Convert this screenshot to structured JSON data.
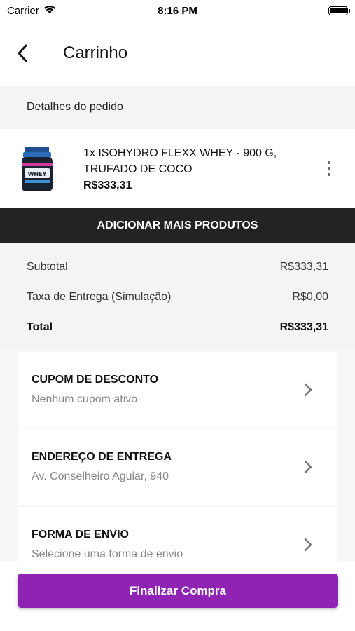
{
  "status_bar": {
    "carrier": "Carrier",
    "time": "8:16 PM"
  },
  "header": {
    "title": "Carrinho"
  },
  "order": {
    "section_title": "Detalhes do pedido",
    "items": [
      {
        "name": "1x ISOHYDRO FLEXX WHEY - 900 G, TRUFADO DE COCO",
        "price": "R$333,31"
      }
    ],
    "add_more_label": "ADICIONAR MAIS PRODUTOS"
  },
  "summary": {
    "subtotal_label": "Subtotal",
    "subtotal_value": "R$333,31",
    "delivery_label": "Taxa de Entrega (Simulação)",
    "delivery_value": "R$0,00",
    "total_label": "Total",
    "total_value": "R$333,31"
  },
  "cards": [
    {
      "title": "CUPOM DE DESCONTO",
      "subtitle": "Nenhum cupom ativo"
    },
    {
      "title": "ENDEREÇO DE ENTREGA",
      "subtitle": "Av. Conselheiro Aguiar, 940"
    },
    {
      "title": "FORMA DE ENVIO",
      "subtitle": "Selecione uma forma de envio"
    }
  ],
  "finalize_label": "Finalizar Compra",
  "colors": {
    "accent": "#8f23b3",
    "dark_bar": "#232323"
  }
}
